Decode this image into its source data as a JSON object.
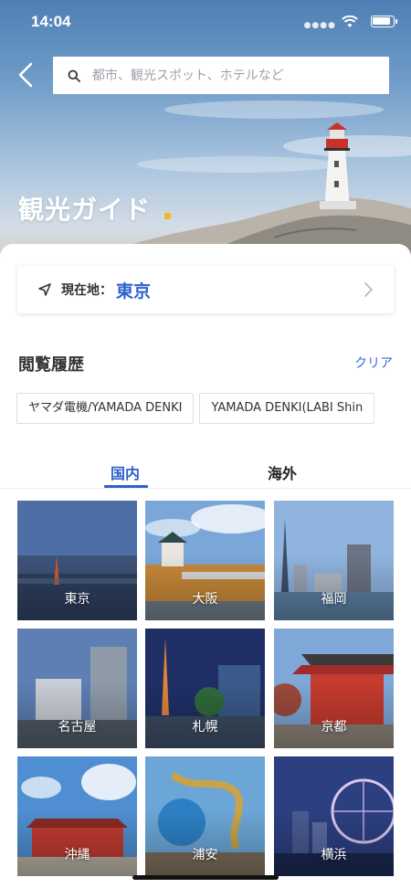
{
  "status_bar": {
    "time": "14:04"
  },
  "search": {
    "placeholder": "都市、観光スポット、ホテルなど"
  },
  "hero": {
    "title": "観光ガイド"
  },
  "location": {
    "label": "現在地：",
    "city": "東京"
  },
  "history": {
    "title": "閲覧履歴",
    "clear_label": "クリア",
    "items": [
      "ヤマダ電機/YAMADA DENKI",
      "YAMADA DENKI(LABI Shin"
    ]
  },
  "tabs": {
    "domestic": "国内",
    "overseas": "海外"
  },
  "cities": [
    "東京",
    "大阪",
    "福岡",
    "名古屋",
    "札幌",
    "京都",
    "沖縄",
    "浦安",
    "横浜"
  ],
  "colors": {
    "accent": "#2f5fd0",
    "hero_dot": "#f6b91c"
  }
}
